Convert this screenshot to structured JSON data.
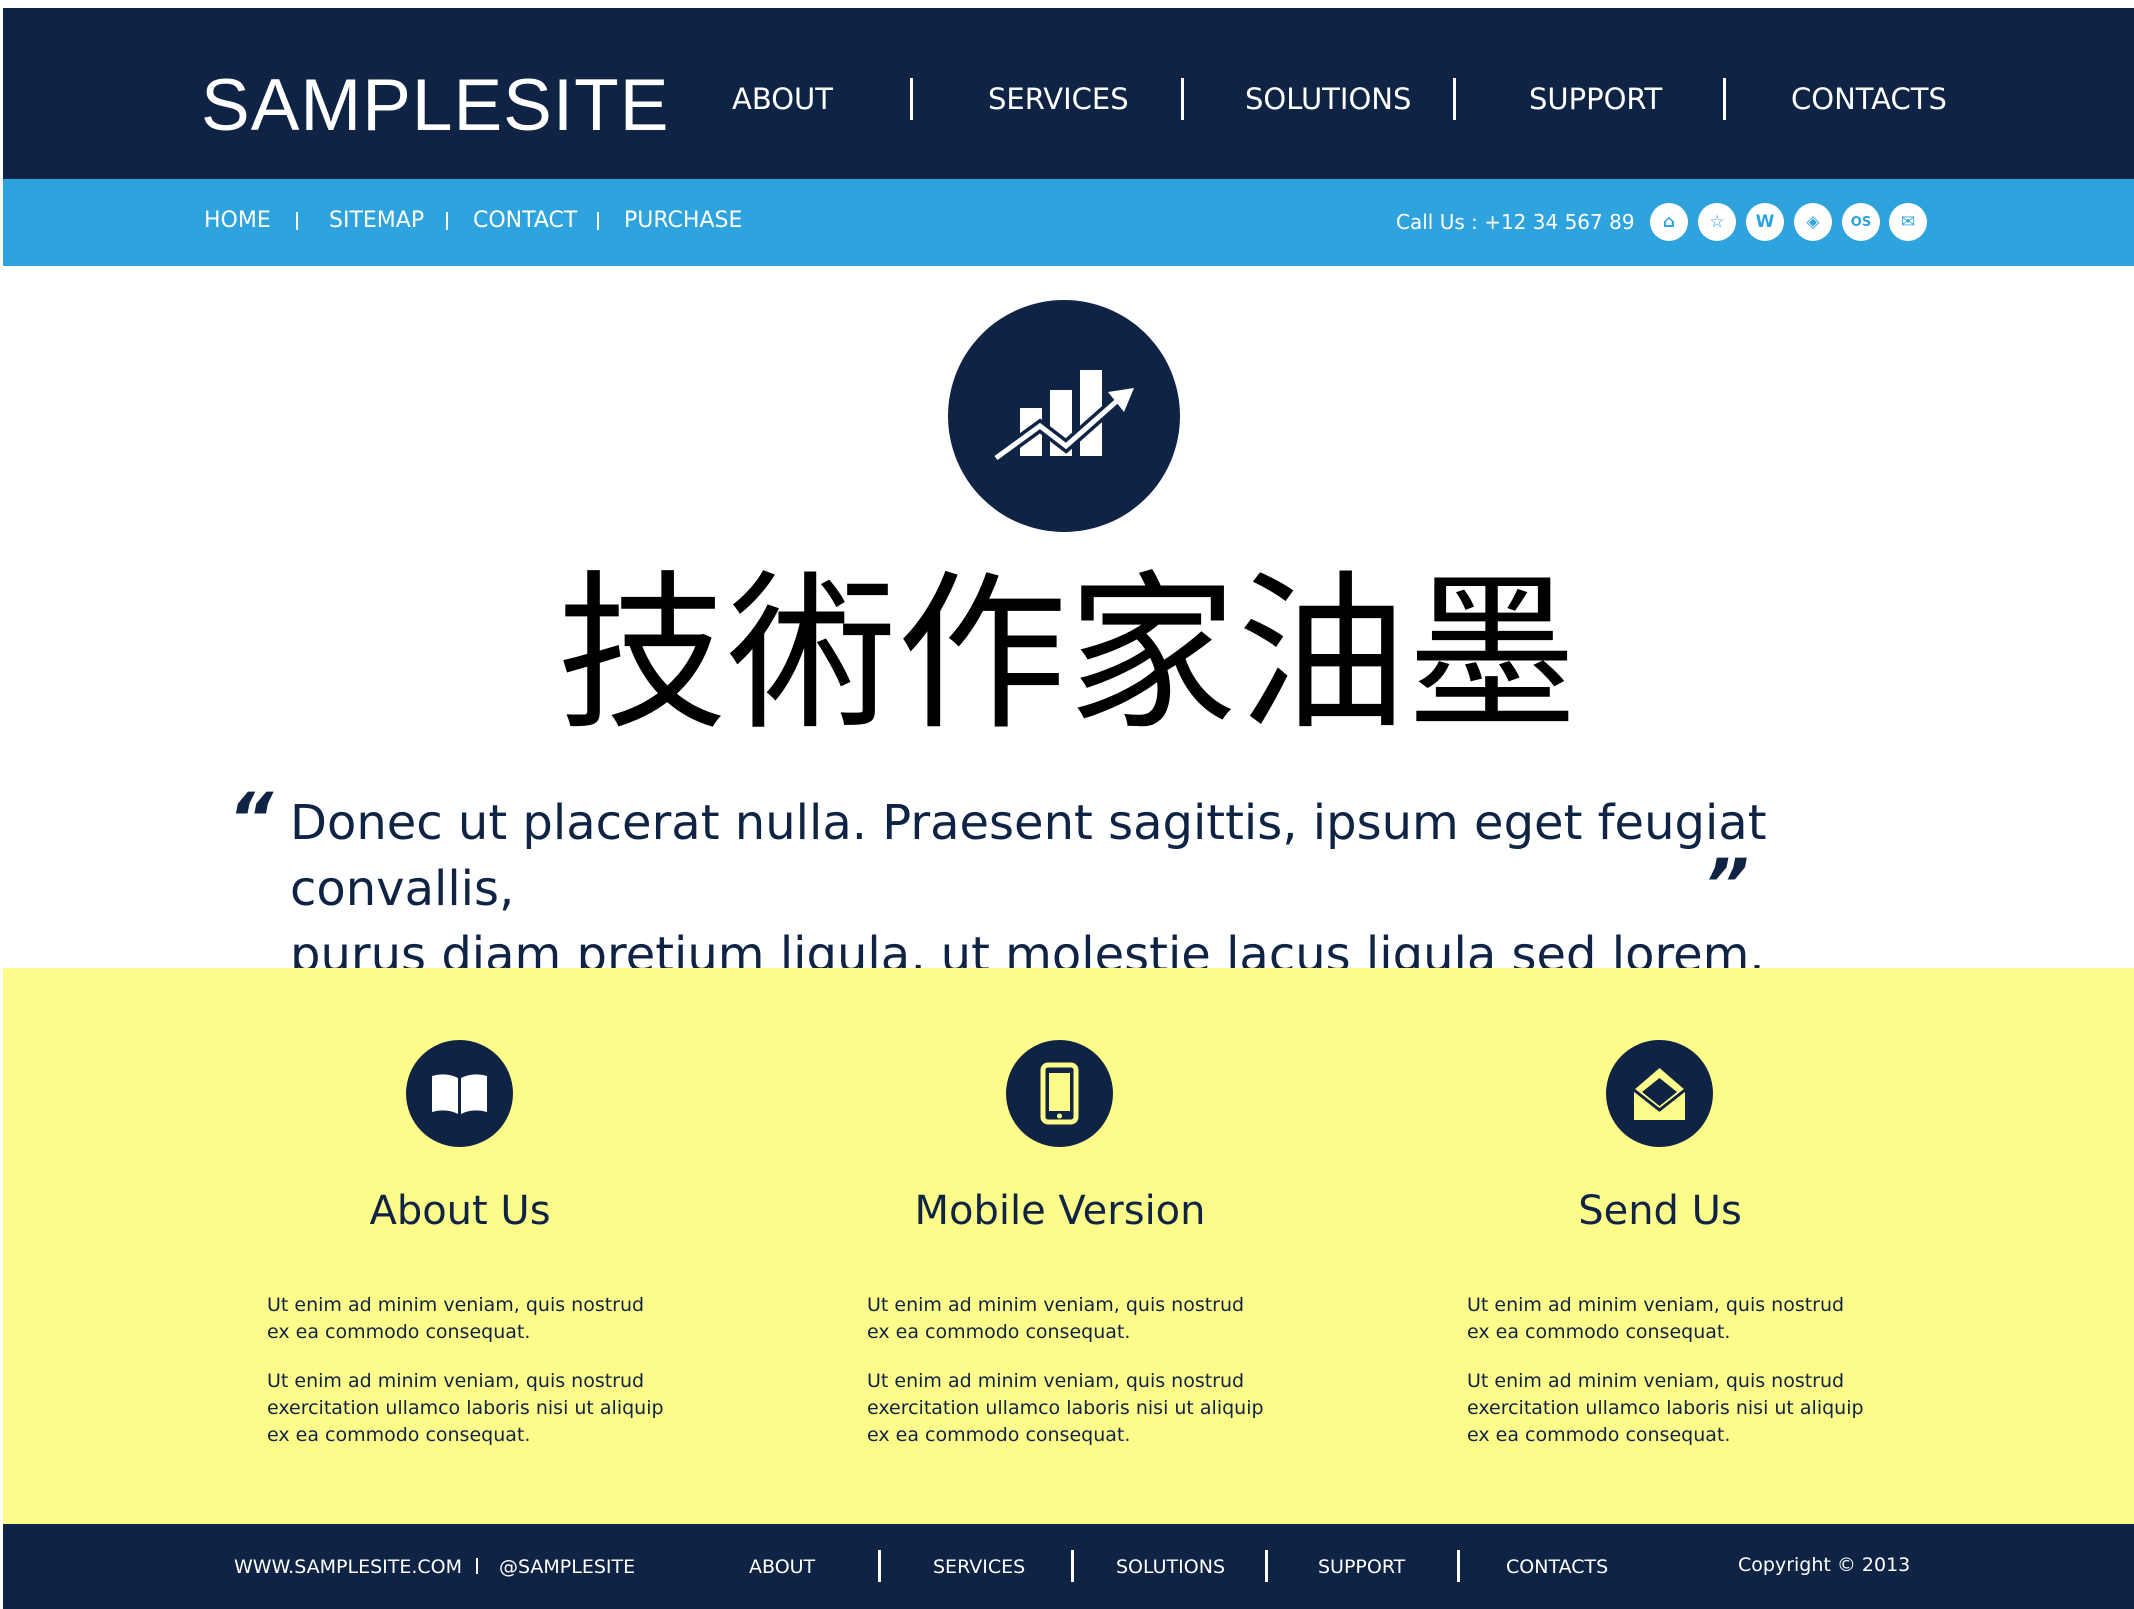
{
  "header": {
    "logo": "SAMPLESITE",
    "nav": [
      "ABOUT",
      "SERVICES",
      "SOLUTIONS",
      "SUPPORT",
      "CONTACTS"
    ]
  },
  "subbar": {
    "links": [
      "HOME",
      "SITEMAP",
      "CONTACT",
      "PURCHASE"
    ],
    "call": "Call Us : +12 34 567 89",
    "social_icons": [
      "home-icon",
      "star-icon",
      "w-icon",
      "compass-icon",
      "os-icon",
      "mail-icon"
    ],
    "social_glyphs": [
      "⌂",
      "☆",
      "W",
      "◈",
      "OS",
      "✉"
    ]
  },
  "hero": {
    "icon": "bar-chart-growth-icon",
    "headline": "技術作家油墨",
    "quote_line1": "Donec ut placerat nulla. Praesent sagittis, ipsum eget feugiat convallis,",
    "quote_line2": "purus diam pretium ligula, ut molestie lacus ligula sed lorem.",
    "quote_open": "“",
    "quote_close": "”"
  },
  "features": [
    {
      "icon": "open-book-icon",
      "title": "About Us",
      "p1a": "Ut enim ad minim veniam, quis nostrud",
      "p1b": "ex ea commodo consequat.",
      "p2a": "Ut enim ad minim veniam, quis nostrud",
      "p2b": "exercitation ullamco laboris nisi ut aliquip",
      "p2c": "ex ea commodo consequat."
    },
    {
      "icon": "tablet-icon",
      "title": "Mobile Version",
      "p1a": "Ut enim ad minim veniam, quis nostrud",
      "p1b": "ex ea commodo consequat.",
      "p2a": "Ut enim ad minim veniam, quis nostrud",
      "p2b": "exercitation ullamco laboris nisi ut aliquip",
      "p2c": "ex ea commodo consequat."
    },
    {
      "icon": "envelope-icon",
      "title": "Send Us",
      "p1a": "Ut enim ad minim veniam, quis nostrud",
      "p1b": "ex ea commodo consequat.",
      "p2a": "Ut enim ad minim veniam, quis nostrud",
      "p2b": "exercitation ullamco laboris nisi ut aliquip",
      "p2c": "ex ea commodo consequat."
    }
  ],
  "footer": {
    "website": "WWW.SAMPLESITE.COM",
    "handle": "@SAMPLESITE",
    "nav": [
      "ABOUT",
      "SERVICES",
      "SOLUTIONS",
      "SUPPORT",
      "CONTACTS"
    ],
    "copyright": "Copyright © 2013"
  },
  "colors": {
    "navy": "#0f2444",
    "blue": "#2ea3de",
    "yellow": "#fdfb8a",
    "white": "#ffffff"
  }
}
